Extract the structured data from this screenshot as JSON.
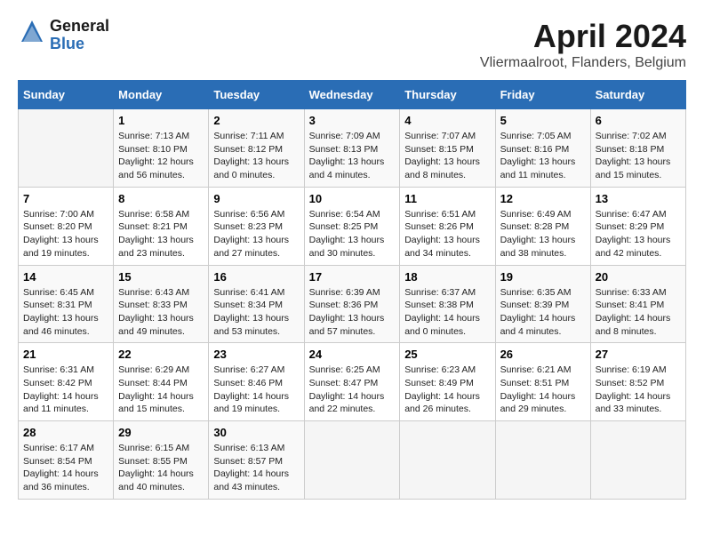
{
  "header": {
    "logo_general": "General",
    "logo_blue": "Blue",
    "month_title": "April 2024",
    "location": "Vliermaalroot, Flanders, Belgium"
  },
  "calendar": {
    "weekdays": [
      "Sunday",
      "Monday",
      "Tuesday",
      "Wednesday",
      "Thursday",
      "Friday",
      "Saturday"
    ],
    "weeks": [
      [
        {
          "day": "",
          "info": ""
        },
        {
          "day": "1",
          "info": "Sunrise: 7:13 AM\nSunset: 8:10 PM\nDaylight: 12 hours\nand 56 minutes."
        },
        {
          "day": "2",
          "info": "Sunrise: 7:11 AM\nSunset: 8:12 PM\nDaylight: 13 hours\nand 0 minutes."
        },
        {
          "day": "3",
          "info": "Sunrise: 7:09 AM\nSunset: 8:13 PM\nDaylight: 13 hours\nand 4 minutes."
        },
        {
          "day": "4",
          "info": "Sunrise: 7:07 AM\nSunset: 8:15 PM\nDaylight: 13 hours\nand 8 minutes."
        },
        {
          "day": "5",
          "info": "Sunrise: 7:05 AM\nSunset: 8:16 PM\nDaylight: 13 hours\nand 11 minutes."
        },
        {
          "day": "6",
          "info": "Sunrise: 7:02 AM\nSunset: 8:18 PM\nDaylight: 13 hours\nand 15 minutes."
        }
      ],
      [
        {
          "day": "7",
          "info": "Sunrise: 7:00 AM\nSunset: 8:20 PM\nDaylight: 13 hours\nand 19 minutes."
        },
        {
          "day": "8",
          "info": "Sunrise: 6:58 AM\nSunset: 8:21 PM\nDaylight: 13 hours\nand 23 minutes."
        },
        {
          "day": "9",
          "info": "Sunrise: 6:56 AM\nSunset: 8:23 PM\nDaylight: 13 hours\nand 27 minutes."
        },
        {
          "day": "10",
          "info": "Sunrise: 6:54 AM\nSunset: 8:25 PM\nDaylight: 13 hours\nand 30 minutes."
        },
        {
          "day": "11",
          "info": "Sunrise: 6:51 AM\nSunset: 8:26 PM\nDaylight: 13 hours\nand 34 minutes."
        },
        {
          "day": "12",
          "info": "Sunrise: 6:49 AM\nSunset: 8:28 PM\nDaylight: 13 hours\nand 38 minutes."
        },
        {
          "day": "13",
          "info": "Sunrise: 6:47 AM\nSunset: 8:29 PM\nDaylight: 13 hours\nand 42 minutes."
        }
      ],
      [
        {
          "day": "14",
          "info": "Sunrise: 6:45 AM\nSunset: 8:31 PM\nDaylight: 13 hours\nand 46 minutes."
        },
        {
          "day": "15",
          "info": "Sunrise: 6:43 AM\nSunset: 8:33 PM\nDaylight: 13 hours\nand 49 minutes."
        },
        {
          "day": "16",
          "info": "Sunrise: 6:41 AM\nSunset: 8:34 PM\nDaylight: 13 hours\nand 53 minutes."
        },
        {
          "day": "17",
          "info": "Sunrise: 6:39 AM\nSunset: 8:36 PM\nDaylight: 13 hours\nand 57 minutes."
        },
        {
          "day": "18",
          "info": "Sunrise: 6:37 AM\nSunset: 8:38 PM\nDaylight: 14 hours\nand 0 minutes."
        },
        {
          "day": "19",
          "info": "Sunrise: 6:35 AM\nSunset: 8:39 PM\nDaylight: 14 hours\nand 4 minutes."
        },
        {
          "day": "20",
          "info": "Sunrise: 6:33 AM\nSunset: 8:41 PM\nDaylight: 14 hours\nand 8 minutes."
        }
      ],
      [
        {
          "day": "21",
          "info": "Sunrise: 6:31 AM\nSunset: 8:42 PM\nDaylight: 14 hours\nand 11 minutes."
        },
        {
          "day": "22",
          "info": "Sunrise: 6:29 AM\nSunset: 8:44 PM\nDaylight: 14 hours\nand 15 minutes."
        },
        {
          "day": "23",
          "info": "Sunrise: 6:27 AM\nSunset: 8:46 PM\nDaylight: 14 hours\nand 19 minutes."
        },
        {
          "day": "24",
          "info": "Sunrise: 6:25 AM\nSunset: 8:47 PM\nDaylight: 14 hours\nand 22 minutes."
        },
        {
          "day": "25",
          "info": "Sunrise: 6:23 AM\nSunset: 8:49 PM\nDaylight: 14 hours\nand 26 minutes."
        },
        {
          "day": "26",
          "info": "Sunrise: 6:21 AM\nSunset: 8:51 PM\nDaylight: 14 hours\nand 29 minutes."
        },
        {
          "day": "27",
          "info": "Sunrise: 6:19 AM\nSunset: 8:52 PM\nDaylight: 14 hours\nand 33 minutes."
        }
      ],
      [
        {
          "day": "28",
          "info": "Sunrise: 6:17 AM\nSunset: 8:54 PM\nDaylight: 14 hours\nand 36 minutes."
        },
        {
          "day": "29",
          "info": "Sunrise: 6:15 AM\nSunset: 8:55 PM\nDaylight: 14 hours\nand 40 minutes."
        },
        {
          "day": "30",
          "info": "Sunrise: 6:13 AM\nSunset: 8:57 PM\nDaylight: 14 hours\nand 43 minutes."
        },
        {
          "day": "",
          "info": ""
        },
        {
          "day": "",
          "info": ""
        },
        {
          "day": "",
          "info": ""
        },
        {
          "day": "",
          "info": ""
        }
      ]
    ]
  }
}
